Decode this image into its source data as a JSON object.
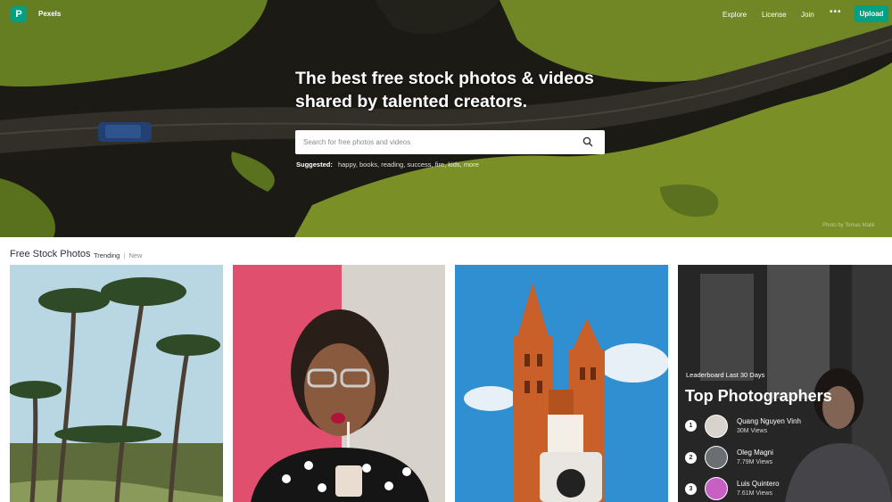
{
  "header": {
    "logo_mark": "P",
    "brand": "Pexels",
    "nav": [
      "Explore",
      "License",
      "Join"
    ],
    "more": "•••",
    "upload_label": "Upload"
  },
  "hero": {
    "headline_line1": "The best free stock photos & videos",
    "headline_line2": "shared by talented creators.",
    "search_placeholder": "Search for free photos and videos",
    "suggested_label": "Suggested:",
    "suggestions": [
      "happy,",
      "books,",
      "reading,",
      "success,",
      "fire,",
      "kids,",
      "more"
    ],
    "credit": "Photo by Tomas Malik"
  },
  "section": {
    "title": "Free Stock Photos",
    "tab_active": "Trending",
    "tab_separator": "|",
    "tab_inactive": "New"
  },
  "leaderboard": {
    "label": "Leaderboard Last 30 Days",
    "title": "Top Photographers",
    "photographers": [
      {
        "rank": "1",
        "name": "Quang Nguyen Vinh",
        "views": "30M Views"
      },
      {
        "rank": "2",
        "name": "Oleg Magni",
        "views": "7.79M Views"
      },
      {
        "rank": "3",
        "name": "Luis Quintero",
        "views": "7.61M Views"
      }
    ]
  },
  "colors": {
    "accent": "#05a081",
    "text": "#2c343e"
  },
  "icons": {
    "search": "search-icon",
    "logo": "pexels-logo-icon"
  }
}
